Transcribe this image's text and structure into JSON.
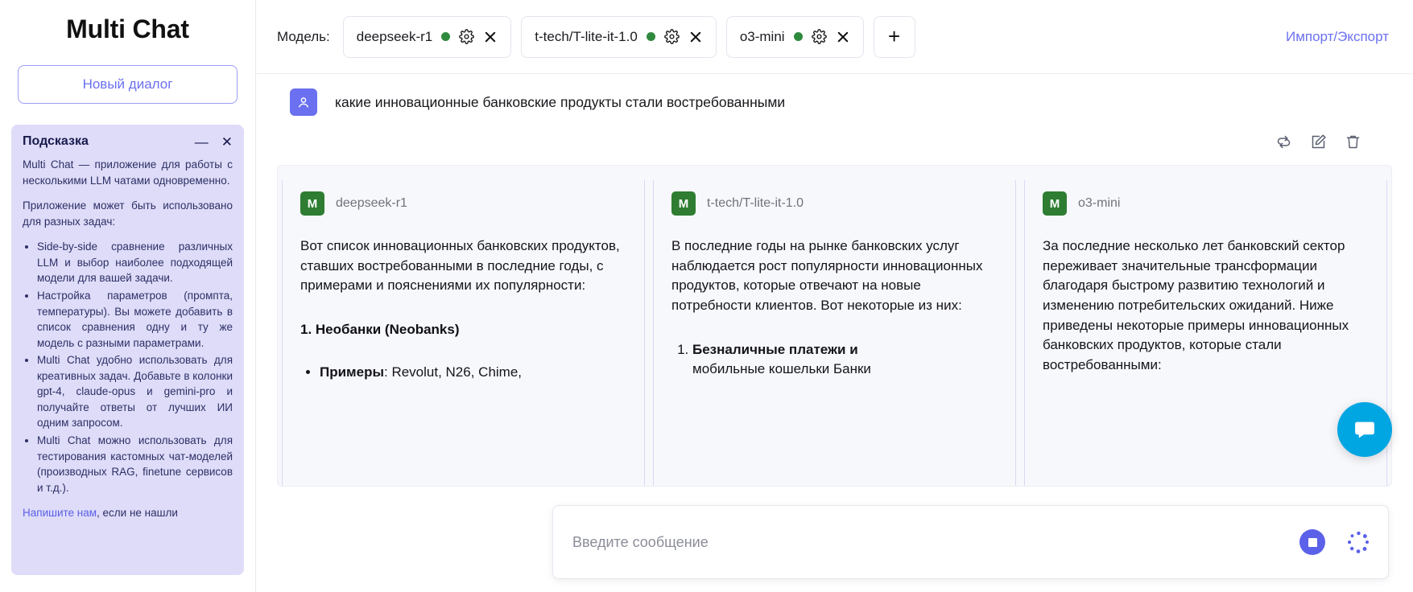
{
  "sidebar": {
    "brand": "Multi Chat",
    "new_dialog_label": "Новый диалог",
    "hint": {
      "title": "Подсказка",
      "minimize_glyph": "—",
      "close_glyph": "✕",
      "paragraph1": "Multi Chat — приложение для работы с несколькими LLM чатами одновременно.",
      "paragraph2": "Приложение может быть использовано для разных задач:",
      "bullets": [
        "Side-by-side сравнение различных LLM и выбор наиболее подходящей модели для вашей задачи.",
        "Настройка параметров (промпта, температуры). Вы можете добавить в список сравнения одну и ту же модель с разными параметрами.",
        "Multi Chat удобно использовать для креативных задач. Добавьте в колонки gpt-4, claude-opus и gemini-pro и получайте ответы от лучших ИИ одним запросом.",
        "Multi Chat можно использовать для тестирования кастомных чат-моделей (производных RAG, finetune сервисов и т.д.)."
      ],
      "footer_link": "Напишите нам",
      "footer_rest": ", если не нашли"
    }
  },
  "topbar": {
    "model_label": "Модель:",
    "models": [
      {
        "name": "deepseek-r1",
        "status_color": "#2f8a3e"
      },
      {
        "name": "t-tech/T-lite-it-1.0",
        "status_color": "#2f8a3e"
      },
      {
        "name": "o3-mini",
        "status_color": "#2f8a3e"
      }
    ],
    "add_model_glyph": "+",
    "import_export_label": "Импорт/Экспорт"
  },
  "conversation": {
    "user_message": "какие инновационные банковские продукты стали востребованными",
    "actions": [
      "regenerate-icon",
      "edit-icon",
      "delete-icon"
    ],
    "responses": [
      {
        "badge": "M",
        "model": "deepseek-r1",
        "paragraph": "Вот список инновационных банковских продуктов, ставших востребованными в последние годы, с примерами и пояснениями их популярности:",
        "heading": "1. Необанки (Neobanks)",
        "bullet_bold": "Примеры",
        "bullet_rest": ": Revolut, N26, Chime,"
      },
      {
        "badge": "M",
        "model": "t-tech/T-lite-it-1.0",
        "paragraph": "В последние годы на рынке банковских услуг наблюдается рост популярности инновационных продуктов, которые отвечают на новые потребности клиентов. Вот некоторые из них:",
        "list_item_bold": "Безналичные платежи и",
        "list_item_cut": "мобильные кошельки Банки"
      },
      {
        "badge": "M",
        "model": "o3-mini",
        "paragraph": "За последние несколько лет банковский сектор переживает значительные трансформации благодаря быстрому развитию технологий и изменению потребительских ожиданий. Ниже приведены некоторые примеры инновационных банковских продуктов, которые стали востребованными:"
      }
    ]
  },
  "composer": {
    "placeholder": "Введите сообщение",
    "value": "",
    "stop_button": "stop-icon",
    "loading": "loading-spinner"
  },
  "fab": {
    "icon": "chat-bubble-icon",
    "color": "#00a6e2"
  },
  "colors": {
    "accent": "#6b70f0",
    "hint_bg": "#dedcf8",
    "card_bg": "#f7f8fc",
    "badge_green": "#2e7d32"
  }
}
